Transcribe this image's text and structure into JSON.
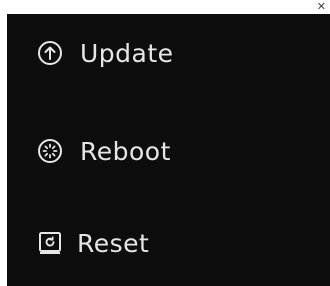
{
  "menu": {
    "items": [
      {
        "label": "Update",
        "icon": "upload-arrow-icon"
      },
      {
        "label": "Reboot",
        "icon": "reboot-spinner-icon"
      },
      {
        "label": "Reset",
        "icon": "reset-book-icon"
      }
    ]
  },
  "colors": {
    "panel_background": "#0d0d0d",
    "text": "#e6e6e6"
  }
}
